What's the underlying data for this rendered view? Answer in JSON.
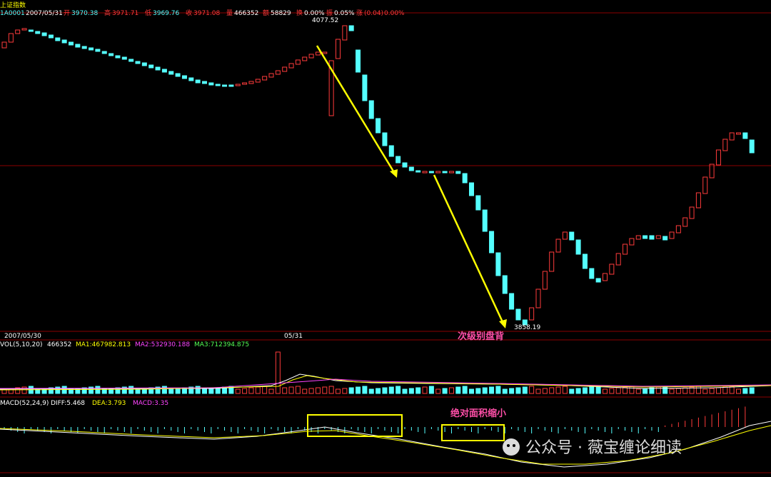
{
  "header": {
    "name": "上证指数",
    "code": "1A0001",
    "date": "2007/05/31",
    "open_label": "开",
    "open": "3970.38",
    "high_label": "高",
    "high": "3971.71",
    "low_label": "低",
    "low": "3969.76",
    "close_label": "收",
    "close": "3971.08",
    "vol_label": "量",
    "vol": "466352",
    "amount_label": "额",
    "amount": "58829",
    "turnover_label": "换",
    "turnover": "0.00%",
    "amplitude_label": "振",
    "amplitude": "0.05%",
    "change_label": "涨",
    "change": "(0.04)",
    "change_pct": "0.00%"
  },
  "price_labels": {
    "high": "4077.52",
    "low": "3858.19"
  },
  "date_axis": {
    "left": "2007/05/30",
    "mid": "05/31"
  },
  "annotations": {
    "divergence": "次级别盘背",
    "area": "绝对面积缩小"
  },
  "vol_legend": {
    "title": "VOL(5,10,20)",
    "value": "466352",
    "ma1": "MA1:467982.813",
    "ma2": "MA2:532930.188",
    "ma3": "MA3:712394.875"
  },
  "macd_legend": {
    "title": "MACD(52,24,9)",
    "diff": "DIFF:5.468",
    "dea": "DEA:3.793",
    "macd": "MACD:3.35"
  },
  "watermark": "公众号 · 薇宝缠论细读",
  "colors": {
    "up": "#ff3b3b",
    "down": "#54ffff",
    "arrow": "#ffff00",
    "box": "#ffff00",
    "note": "#ff4fa8",
    "grid": "#8b0000"
  },
  "chart_data": {
    "type": "candlestick",
    "price_range": [
      3858.19,
      4077.52
    ],
    "y_pixel_anchor": "visual",
    "candles": [
      [
        1,
        59,
        67
      ],
      [
        1,
        47,
        59
      ],
      [
        1,
        42,
        47
      ],
      [
        1,
        40,
        42
      ],
      [
        0,
        42,
        44
      ],
      [
        0,
        44,
        47
      ],
      [
        0,
        46,
        50
      ],
      [
        0,
        49,
        53
      ],
      [
        0,
        53,
        57
      ],
      [
        0,
        56,
        60
      ],
      [
        0,
        59,
        63
      ],
      [
        0,
        62,
        66
      ],
      [
        0,
        65,
        68
      ],
      [
        0,
        67,
        70
      ],
      [
        0,
        69,
        72
      ],
      [
        0,
        72,
        75
      ],
      [
        0,
        75,
        78
      ],
      [
        0,
        78,
        81
      ],
      [
        0,
        80,
        83
      ],
      [
        0,
        83,
        86
      ],
      [
        0,
        86,
        89
      ],
      [
        0,
        88,
        92
      ],
      [
        0,
        91,
        95
      ],
      [
        0,
        94,
        98
      ],
      [
        0,
        97,
        101
      ],
      [
        0,
        100,
        104
      ],
      [
        0,
        103,
        107
      ],
      [
        0,
        106,
        110
      ],
      [
        0,
        109,
        113
      ],
      [
        0,
        112,
        116
      ],
      [
        0,
        114,
        117
      ],
      [
        0,
        116,
        119
      ],
      [
        0,
        118,
        120
      ],
      [
        0,
        119,
        121
      ],
      [
        0,
        119,
        121
      ],
      [
        1,
        118,
        120
      ],
      [
        1,
        116,
        118
      ],
      [
        1,
        114,
        117
      ],
      [
        1,
        111,
        115
      ],
      [
        1,
        107,
        112
      ],
      [
        1,
        103,
        108
      ],
      [
        1,
        99,
        104
      ],
      [
        1,
        94,
        100
      ],
      [
        1,
        89,
        95
      ],
      [
        1,
        84,
        90
      ],
      [
        1,
        80,
        85
      ],
      [
        1,
        76,
        81
      ],
      [
        1,
        73,
        77
      ],
      [
        1,
        73,
        75
      ],
      [
        1,
        85,
        162
      ],
      [
        1,
        55,
        82
      ],
      [
        1,
        36,
        56
      ],
      [
        0,
        36,
        43
      ],
      [
        0,
        70,
        101
      ],
      [
        0,
        105,
        141
      ],
      [
        0,
        141,
        166
      ],
      [
        0,
        166,
        186
      ],
      [
        0,
        186,
        204
      ],
      [
        0,
        204,
        219
      ],
      [
        0,
        219,
        228
      ],
      [
        0,
        228,
        234
      ],
      [
        0,
        234,
        239
      ],
      [
        0,
        239,
        241
      ],
      [
        1,
        240,
        242
      ],
      [
        0,
        240,
        242
      ],
      [
        1,
        240,
        242
      ],
      [
        0,
        240,
        242
      ],
      [
        1,
        240,
        242
      ],
      [
        0,
        240,
        243
      ],
      [
        0,
        243,
        256
      ],
      [
        0,
        256,
        274
      ],
      [
        0,
        274,
        294
      ],
      [
        0,
        294,
        324
      ],
      [
        0,
        324,
        354
      ],
      [
        0,
        354,
        386
      ],
      [
        0,
        386,
        411
      ],
      [
        0,
        411,
        433
      ],
      [
        0,
        433,
        448
      ],
      [
        0,
        448,
        455
      ],
      [
        1,
        431,
        448
      ],
      [
        1,
        405,
        431
      ],
      [
        1,
        380,
        405
      ],
      [
        1,
        353,
        380
      ],
      [
        1,
        335,
        353
      ],
      [
        1,
        325,
        335
      ],
      [
        0,
        325,
        336
      ],
      [
        0,
        336,
        356
      ],
      [
        0,
        356,
        376
      ],
      [
        0,
        376,
        390
      ],
      [
        0,
        390,
        395
      ],
      [
        1,
        383,
        393
      ],
      [
        1,
        370,
        384
      ],
      [
        1,
        355,
        371
      ],
      [
        1,
        342,
        356
      ],
      [
        1,
        334,
        343
      ],
      [
        1,
        330,
        335
      ],
      [
        0,
        330,
        334
      ],
      [
        0,
        330,
        335
      ],
      [
        1,
        330,
        334
      ],
      [
        0,
        331,
        336
      ],
      [
        1,
        325,
        334
      ],
      [
        1,
        316,
        326
      ],
      [
        1,
        305,
        317
      ],
      [
        1,
        290,
        306
      ],
      [
        1,
        270,
        291
      ],
      [
        1,
        248,
        271
      ],
      [
        1,
        230,
        249
      ],
      [
        1,
        210,
        231
      ],
      [
        1,
        195,
        211
      ],
      [
        1,
        186,
        196
      ],
      [
        1,
        186,
        188
      ],
      [
        0,
        186,
        194
      ],
      [
        0,
        196,
        214
      ]
    ]
  }
}
